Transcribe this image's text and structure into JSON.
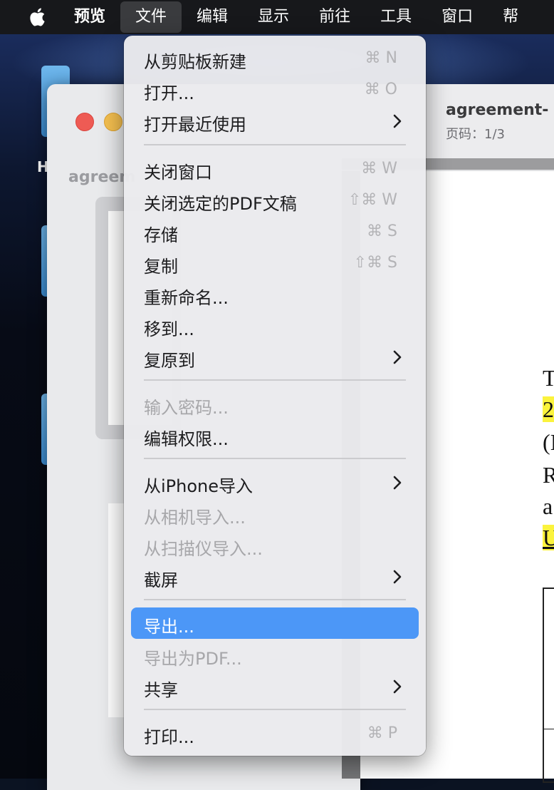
{
  "menubar": {
    "app_name": "预览",
    "menus": [
      "文件",
      "编辑",
      "显示",
      "前往",
      "工具",
      "窗口",
      "帮"
    ]
  },
  "desktop": {
    "label": "H"
  },
  "sidebar_window": {
    "title": "agreem"
  },
  "document_window": {
    "title": "agreement-",
    "page_info": "页码：1/3",
    "page_text": [
      "T",
      "2",
      "(I",
      "R",
      "a",
      "U"
    ]
  },
  "file_menu": {
    "items": [
      {
        "label": "从剪贴板新建",
        "shortcut": "⌘ N"
      },
      {
        "label": "打开...",
        "shortcut": "⌘ O"
      },
      {
        "label": "打开最近使用"
      },
      {
        "label": "关闭窗口",
        "shortcut": "⌘ W"
      },
      {
        "label": "关闭选定的PDF文稿",
        "shortcut": "⇧⌘ W"
      },
      {
        "label": "存储",
        "shortcut": "⌘ S"
      },
      {
        "label": "复制",
        "shortcut": "⇧⌘ S"
      },
      {
        "label": "重新命名..."
      },
      {
        "label": "移到..."
      },
      {
        "label": "复原到"
      },
      {
        "label": "输入密码..."
      },
      {
        "label": "编辑权限..."
      },
      {
        "label": "从iPhone导入"
      },
      {
        "label": "从相机导入..."
      },
      {
        "label": "从扫描仪导入..."
      },
      {
        "label": "截屏"
      },
      {
        "label": "导出..."
      },
      {
        "label": "导出为PDF..."
      },
      {
        "label": "共享"
      },
      {
        "label": "打印...",
        "shortcut": "⌘ P"
      }
    ]
  },
  "colors": {
    "menu_highlight": "#4c97f7",
    "text_highlight": "#fbf33d"
  }
}
